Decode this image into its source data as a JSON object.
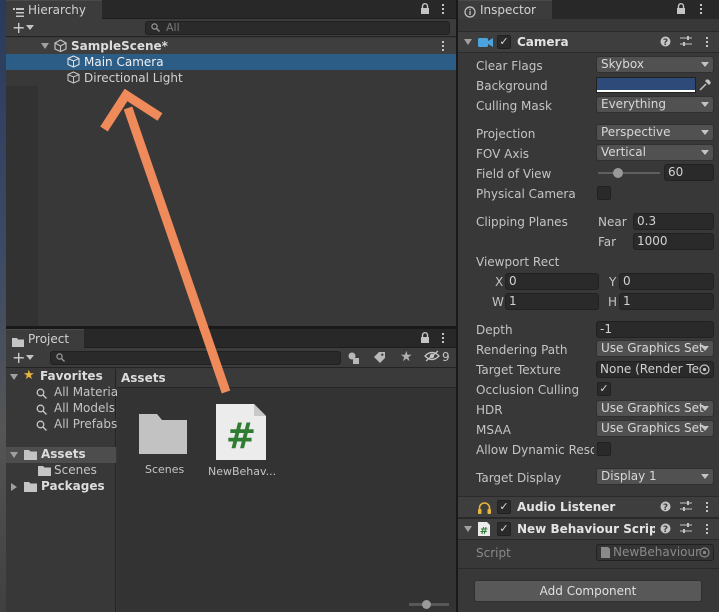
{
  "hierarchy": {
    "tab_label": "Hierarchy",
    "search_placeholder": "All",
    "scene_name": "SampleScene*",
    "items": [
      {
        "label": "Main Camera",
        "selected": true
      },
      {
        "label": "Directional Light",
        "selected": false
      }
    ]
  },
  "project": {
    "tab_label": "Project",
    "hidden_count": "9",
    "favorites": {
      "label": "Favorites",
      "items": [
        "All Materia",
        "All Models",
        "All Prefabs"
      ]
    },
    "tree": {
      "assets_label": "Assets",
      "scenes_label": "Scenes",
      "packages_label": "Packages"
    },
    "breadcrumb": "Assets",
    "grid_items": [
      {
        "label": "Scenes",
        "type": "folder-icon"
      },
      {
        "label": "NewBehav...",
        "type": "csharp-script-icon"
      }
    ]
  },
  "inspector": {
    "tab_label": "Inspector",
    "camera": {
      "title": "Camera",
      "fields": {
        "clear_flags_label": "Clear Flags",
        "clear_flags_value": "Skybox",
        "background_label": "Background",
        "background_color": "#2d4a78",
        "culling_mask_label": "Culling Mask",
        "culling_mask_value": "Everything",
        "projection_label": "Projection",
        "projection_value": "Perspective",
        "fov_axis_label": "FOV Axis",
        "fov_axis_value": "Vertical",
        "fov_label": "Field of View",
        "fov_value": "60",
        "fov_slider_fraction": 0.33,
        "physical_camera_label": "Physical Camera",
        "clipping_label": "Clipping Planes",
        "near_label": "Near",
        "near_value": "0.3",
        "far_label": "Far",
        "far_value": "1000",
        "viewport_label": "Viewport Rect",
        "x_label": "X",
        "x_value": "0",
        "y_label": "Y",
        "y_value": "0",
        "w_label": "W",
        "w_value": "1",
        "h_label": "H",
        "h_value": "1",
        "depth_label": "Depth",
        "depth_value": "-1",
        "rendering_path_label": "Rendering Path",
        "rendering_path_value": "Use Graphics Set",
        "target_texture_label": "Target Texture",
        "target_texture_value": "None (Render Te",
        "occlusion_label": "Occlusion Culling",
        "hdr_label": "HDR",
        "hdr_value": "Use Graphics Set",
        "msaa_label": "MSAA",
        "msaa_value": "Use Graphics Set",
        "dynamic_res_label": "Allow Dynamic Resol",
        "target_display_label": "Target Display",
        "target_display_value": "Display 1"
      }
    },
    "audio_listener": {
      "title": "Audio Listener"
    },
    "new_behaviour": {
      "title": "New Behaviour Script (S",
      "script_label": "Script",
      "script_value": "NewBehaviour"
    },
    "add_component_label": "Add Component"
  },
  "colors": {
    "selection": "#2c5d87",
    "annotation_arrow": "#ef8a5a",
    "csharp_green": "#2e7d32",
    "camera_icon": "#4aa3df",
    "favorites_star": "#e8b63c",
    "headphones_icon": "#e8b63c"
  }
}
